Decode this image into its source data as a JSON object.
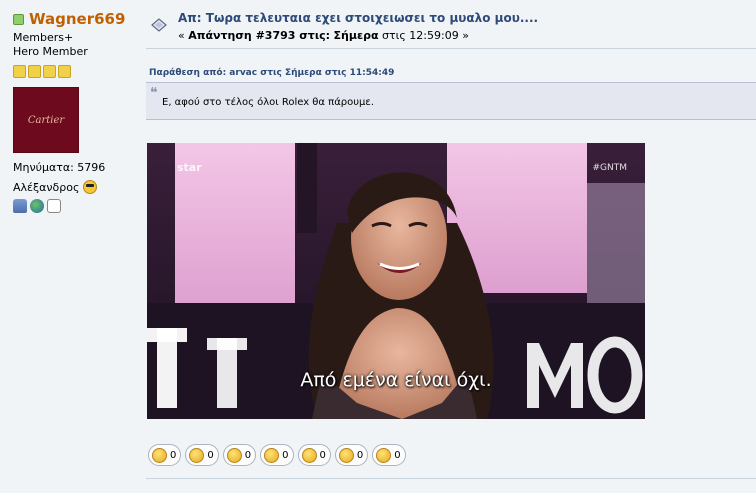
{
  "poster": {
    "name": "Wagner669",
    "group": "Members+",
    "rank": "Hero Member",
    "avatar_text": "Cartier",
    "posts": "Μηνύματα: 5796",
    "location": "Αλέξανδρος"
  },
  "post": {
    "subject": "Απ: Τωρα τελευταια εχει στοιχειωσει το μυαλο μου....",
    "reply_prefix": "«",
    "reply_label": "Απάντηση #3793 στις:",
    "reply_day": "Σήμερα",
    "reply_time": "στις 12:59:09",
    "reply_suffix": "»",
    "quote_header": "Παράθεση από: arvac στις Σήμερα στις 11:54:49",
    "quote_text": "Ε, αφού στο τέλος όλοι Rolex θα πάρουμε.",
    "gif_caption": "Από εμένα είναι όχι.",
    "gif_logo": "star",
    "gif_tag": "#GNTM"
  },
  "reactions": [
    {
      "icon": "smile-icon",
      "count": "0"
    },
    {
      "icon": "laugh-icon",
      "count": "0"
    },
    {
      "icon": "shock-icon",
      "count": "0"
    },
    {
      "icon": "thumbs-up-icon",
      "count": "0"
    },
    {
      "icon": "thumbs-down-icon",
      "count": "0"
    },
    {
      "icon": "confused-icon",
      "count": "0"
    },
    {
      "icon": "angry-icon",
      "count": "0"
    }
  ],
  "colors": {
    "background": "#f0f4f7",
    "username": "#c06000",
    "subject": "#2d4a78",
    "quote_bg": "#e4e6f0"
  }
}
